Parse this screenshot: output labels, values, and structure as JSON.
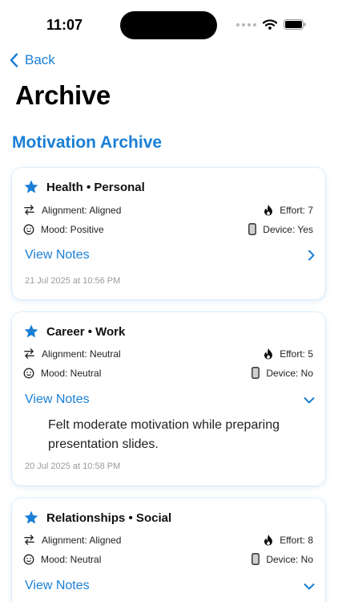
{
  "status_bar": {
    "time": "11:07"
  },
  "nav": {
    "back_label": "Back"
  },
  "page": {
    "title": "Archive",
    "section_title": "Motivation Archive"
  },
  "colors": {
    "accent": "#1a7fd6",
    "timestamp": "#9a9a9a"
  },
  "cards": [
    {
      "title": "Health • Personal",
      "alignment": "Alignment: Aligned",
      "effort": "Effort: 7",
      "mood": "Mood: Positive",
      "device": "Device: Yes",
      "notes_label": "View Notes",
      "expanded": false,
      "note": "",
      "timestamp": "21 Jul 2025 at 10:56 PM"
    },
    {
      "title": "Career • Work",
      "alignment": "Alignment: Neutral",
      "effort": "Effort: 5",
      "mood": "Mood: Neutral",
      "device": "Device: No",
      "notes_label": "View Notes",
      "expanded": true,
      "note": "Felt moderate motivation while preparing presentation slides.",
      "timestamp": "20 Jul 2025 at 10:58 PM"
    },
    {
      "title": "Relationships • Social",
      "alignment": "Alignment: Aligned",
      "effort": "Effort: 8",
      "mood": "Mood: Neutral",
      "device": "Device: No",
      "notes_label": "View Notes",
      "expanded": true,
      "note": "",
      "timestamp": ""
    }
  ]
}
